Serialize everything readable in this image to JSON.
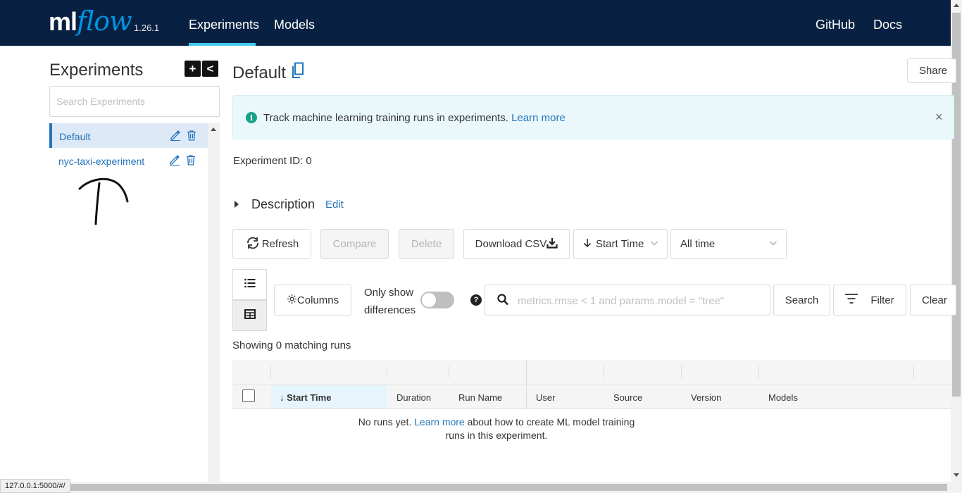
{
  "header": {
    "logo_ml": "ml",
    "logo_flow": "flow",
    "version": "1.26.1",
    "nav": [
      "Experiments",
      "Models"
    ],
    "nav_right": [
      "GitHub",
      "Docs"
    ],
    "active_nav": "Experiments"
  },
  "sidebar": {
    "title": "Experiments",
    "add_symbol": "+",
    "collapse_symbol": "<",
    "search_placeholder": "Search Experiments",
    "experiments": [
      {
        "name": "Default",
        "active": true
      },
      {
        "name": "nyc-taxi-experiment",
        "active": false
      }
    ]
  },
  "main": {
    "title": "Default",
    "share_label": "Share",
    "banner": {
      "icon": "i",
      "text": "Track machine learning training runs in experiments. ",
      "link": "Learn more",
      "close": "×"
    },
    "experiment_id_label": "Experiment ID:",
    "experiment_id_value": "0",
    "description_label": "Description",
    "description_edit": "Edit",
    "toolbar": {
      "refresh": "Refresh",
      "compare": "Compare",
      "delete": "Delete",
      "download": "Download CSV",
      "sort_label": "Start Time",
      "time_label": "All time"
    },
    "filters": {
      "columns": "Columns",
      "only_show_line1": "Only show",
      "only_show_line2": "differences",
      "help": "?",
      "search_placeholder": "metrics.rmse < 1 and params.model = \"tree\"",
      "search_btn": "Search",
      "filter_btn": "Filter",
      "clear_btn": "Clear"
    },
    "showing": "Showing 0 matching runs",
    "table": {
      "columns": [
        "Start Time",
        "Duration",
        "Run Name",
        "User",
        "Source",
        "Version",
        "Models"
      ],
      "sort_arrow": "↓"
    },
    "empty": {
      "pre": "No runs yet. ",
      "link": "Learn more",
      "post1": " about how to create ML model training",
      "post2": "runs in this experiment."
    }
  },
  "status_url": "127.0.0.1:5000/#/",
  "colors": {
    "header_bg": "#082142",
    "accent": "#43c9ed",
    "link": "#2374bb",
    "logo_flow": "#0194e2",
    "banner_bg": "#eaf8fc"
  }
}
